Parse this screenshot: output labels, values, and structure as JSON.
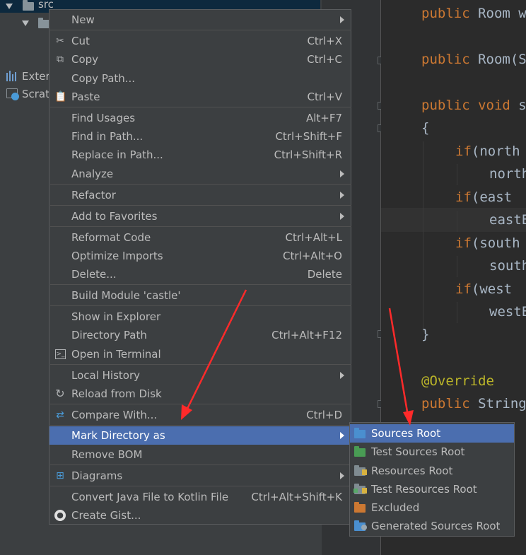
{
  "project": {
    "root_label": "src",
    "external_label": "Exter",
    "scratches_label": "Scrat"
  },
  "editor": {
    "lines": [
      {
        "kw": "public",
        "text": " Room w"
      },
      {
        "kw": "public",
        "text": " Room(S"
      },
      {
        "kw": "public void",
        "text": " s"
      },
      {
        "kw": "",
        "text": "{"
      },
      {
        "kw": "if",
        "text": "(north"
      },
      {
        "kw": "",
        "text": "north"
      },
      {
        "kw": "if",
        "text": "(east "
      },
      {
        "kw": "",
        "text": "eastE"
      },
      {
        "kw": "if",
        "text": "(south"
      },
      {
        "kw": "",
        "text": "south"
      },
      {
        "kw": "if",
        "text": "(west "
      },
      {
        "kw": "",
        "text": "westE"
      },
      {
        "kw": "",
        "text": "}"
      },
      {
        "ann": "@Override"
      },
      {
        "kw": "public",
        "text": " String"
      }
    ]
  },
  "menu": {
    "items": [
      {
        "label": "New",
        "shortcut": "",
        "submenu": true,
        "icon": ""
      },
      {
        "label": "Cut",
        "shortcut": "Ctrl+X",
        "submenu": false,
        "icon": "scissors-icon"
      },
      {
        "label": "Copy",
        "shortcut": "Ctrl+C",
        "submenu": false,
        "icon": "copy-icon"
      },
      {
        "label": "Copy Path...",
        "shortcut": "",
        "submenu": false,
        "icon": ""
      },
      {
        "label": "Paste",
        "shortcut": "Ctrl+V",
        "submenu": false,
        "icon": "clipboard-icon"
      },
      {
        "label": "Find Usages",
        "shortcut": "Alt+F7",
        "submenu": false,
        "icon": ""
      },
      {
        "label": "Find in Path...",
        "shortcut": "Ctrl+Shift+F",
        "submenu": false,
        "icon": ""
      },
      {
        "label": "Replace in Path...",
        "shortcut": "Ctrl+Shift+R",
        "submenu": false,
        "icon": ""
      },
      {
        "label": "Analyze",
        "shortcut": "",
        "submenu": true,
        "icon": ""
      },
      {
        "label": "Refactor",
        "shortcut": "",
        "submenu": true,
        "icon": ""
      },
      {
        "label": "Add to Favorites",
        "shortcut": "",
        "submenu": true,
        "icon": ""
      },
      {
        "label": "Reformat Code",
        "shortcut": "Ctrl+Alt+L",
        "submenu": false,
        "icon": ""
      },
      {
        "label": "Optimize Imports",
        "shortcut": "Ctrl+Alt+O",
        "submenu": false,
        "icon": ""
      },
      {
        "label": "Delete...",
        "shortcut": "Delete",
        "submenu": false,
        "icon": ""
      },
      {
        "label": "Build Module 'castle'",
        "shortcut": "",
        "submenu": false,
        "icon": ""
      },
      {
        "label": "Show in Explorer",
        "shortcut": "",
        "submenu": false,
        "icon": ""
      },
      {
        "label": "Directory Path",
        "shortcut": "Ctrl+Alt+F12",
        "submenu": false,
        "icon": ""
      },
      {
        "label": "Open in Terminal",
        "shortcut": "",
        "submenu": false,
        "icon": "terminal-icon"
      },
      {
        "label": "Local History",
        "shortcut": "",
        "submenu": true,
        "icon": ""
      },
      {
        "label": "Reload from Disk",
        "shortcut": "",
        "submenu": false,
        "icon": "reload-icon"
      },
      {
        "label": "Compare With...",
        "shortcut": "Ctrl+D",
        "submenu": false,
        "icon": "compare-icon"
      },
      {
        "label": "Mark Directory as",
        "shortcut": "",
        "submenu": true,
        "icon": "",
        "selected": true
      },
      {
        "label": "Remove BOM",
        "shortcut": "",
        "submenu": false,
        "icon": ""
      },
      {
        "label": "Diagrams",
        "shortcut": "",
        "submenu": true,
        "icon": "diagram-icon"
      },
      {
        "label": "Convert Java File to Kotlin File",
        "shortcut": "Ctrl+Alt+Shift+K",
        "submenu": false,
        "icon": ""
      },
      {
        "label": "Create Gist...",
        "shortcut": "",
        "submenu": false,
        "icon": "github-icon"
      }
    ]
  },
  "submenu": {
    "items": [
      {
        "label": "Sources Root",
        "color": "#4a8fcf",
        "icon": "sources-root-folder-icon",
        "selected": true
      },
      {
        "label": "Test Sources Root",
        "color": "#499c54",
        "icon": "test-sources-root-folder-icon"
      },
      {
        "label": "Resources Root",
        "color": "#7f8b91",
        "icon": "resources-root-folder-icon"
      },
      {
        "label": "Test Resources Root",
        "color": "#7f8b91",
        "icon": "test-resources-root-folder-icon"
      },
      {
        "label": "Excluded",
        "color": "#cc7832",
        "icon": "excluded-folder-icon"
      },
      {
        "label": "Generated Sources Root",
        "color": "#4a8fcf",
        "icon": "generated-sources-root-folder-icon"
      }
    ]
  },
  "annotation_color": "#ff2a2a"
}
